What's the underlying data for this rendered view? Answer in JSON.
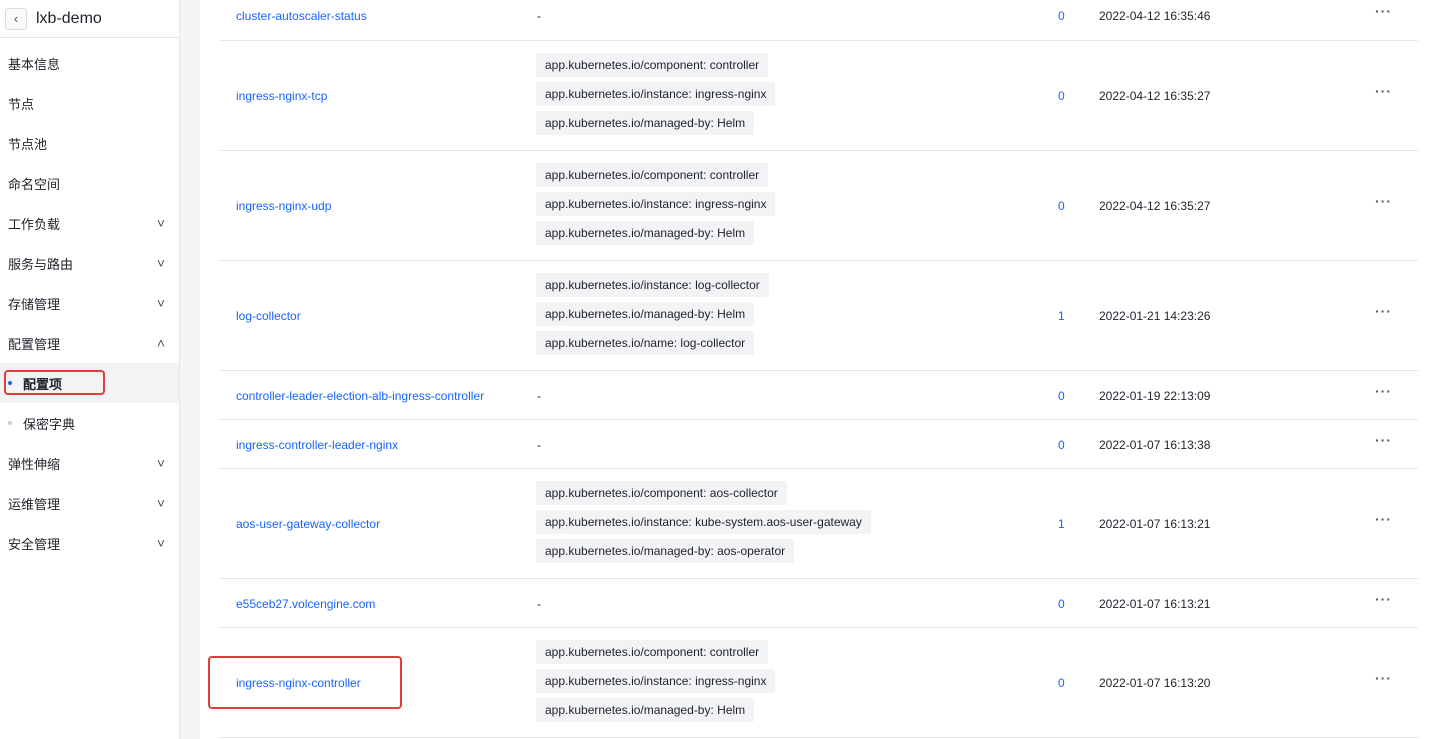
{
  "sidebar": {
    "back_icon": "chevron-left-icon",
    "title": "lxb-demo",
    "menu": [
      {
        "label": "基本信息",
        "expandable": false
      },
      {
        "label": "节点",
        "expandable": false
      },
      {
        "label": "节点池",
        "expandable": false
      },
      {
        "label": "命名空间",
        "expandable": false
      },
      {
        "label": "工作负载",
        "expandable": true,
        "expanded": false
      },
      {
        "label": "服务与路由",
        "expandable": true,
        "expanded": false
      },
      {
        "label": "存储管理",
        "expandable": true,
        "expanded": false
      },
      {
        "label": "配置管理",
        "expandable": true,
        "expanded": true
      },
      {
        "label": "配置项",
        "sub": true,
        "active": true
      },
      {
        "label": "保密字典",
        "sub": true,
        "active": false
      },
      {
        "label": "弹性伸缩",
        "expandable": true,
        "expanded": false
      },
      {
        "label": "运维管理",
        "expandable": true,
        "expanded": false
      },
      {
        "label": "安全管理",
        "expandable": true,
        "expanded": false
      }
    ]
  },
  "table": {
    "more_label": "···",
    "rows": [
      {
        "name": "cluster-autoscaler-status",
        "labels": [],
        "dash": "-",
        "count": "0",
        "date": "2022-04-12 16:35:46"
      },
      {
        "name": "ingress-nginx-tcp",
        "labels": [
          "app.kubernetes.io/component: controller",
          "app.kubernetes.io/instance: ingress-nginx",
          "app.kubernetes.io/managed-by: Helm"
        ],
        "count": "0",
        "date": "2022-04-12 16:35:27"
      },
      {
        "name": "ingress-nginx-udp",
        "labels": [
          "app.kubernetes.io/component: controller",
          "app.kubernetes.io/instance: ingress-nginx",
          "app.kubernetes.io/managed-by: Helm"
        ],
        "count": "0",
        "date": "2022-04-12 16:35:27"
      },
      {
        "name": "log-collector",
        "labels": [
          "app.kubernetes.io/instance: log-collector",
          "app.kubernetes.io/managed-by: Helm",
          "app.kubernetes.io/name: log-collector"
        ],
        "count": "1",
        "date": "2022-01-21 14:23:26"
      },
      {
        "name": "controller-leader-election-alb-ingress-controller",
        "labels": [],
        "dash": "-",
        "count": "0",
        "date": "2022-01-19 22:13:09"
      },
      {
        "name": "ingress-controller-leader-nginx",
        "labels": [],
        "dash": "-",
        "count": "0",
        "date": "2022-01-07 16:13:38"
      },
      {
        "name": "aos-user-gateway-collector",
        "labels": [
          "app.kubernetes.io/component: aos-collector",
          "app.kubernetes.io/instance: kube-system.aos-user-gateway",
          "app.kubernetes.io/managed-by: aos-operator"
        ],
        "count": "1",
        "date": "2022-01-07 16:13:21"
      },
      {
        "name": "e55ceb27.volcengine.com",
        "labels": [],
        "dash": "-",
        "count": "0",
        "date": "2022-01-07 16:13:21"
      },
      {
        "name": "ingress-nginx-controller",
        "labels": [
          "app.kubernetes.io/component: controller",
          "app.kubernetes.io/instance: ingress-nginx",
          "app.kubernetes.io/managed-by: Helm"
        ],
        "count": "0",
        "date": "2022-01-07 16:13:20"
      }
    ]
  }
}
